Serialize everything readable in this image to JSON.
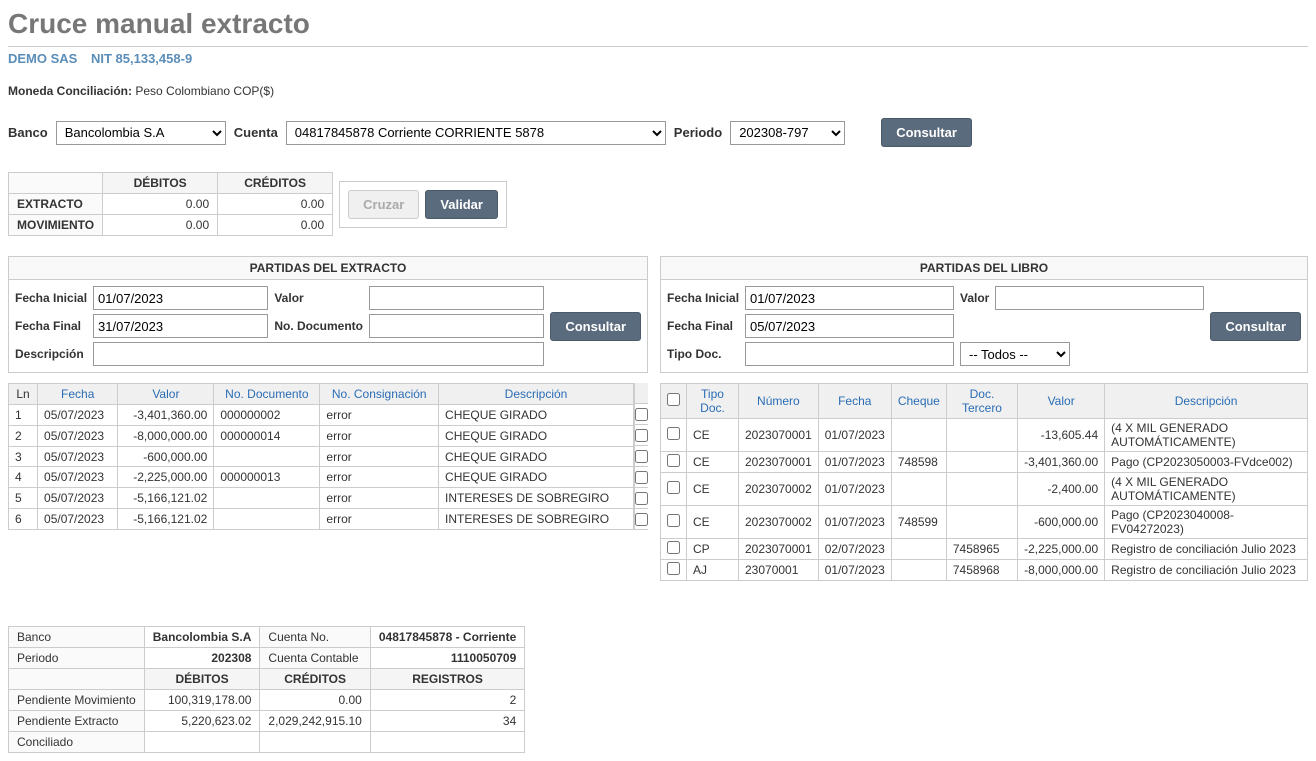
{
  "page": {
    "title": "Cruce manual extracto",
    "company": "DEMO SAS",
    "nit_label": "NIT",
    "nit": "85,133,458-9",
    "moneda_label": "Moneda Conciliación:",
    "moneda_value": "Peso Colombiano COP($)"
  },
  "filters": {
    "banco_label": "Banco",
    "banco_value": "Bancolombia S.A",
    "cuenta_label": "Cuenta",
    "cuenta_value": "04817845878 Corriente CORRIENTE 5878",
    "periodo_label": "Periodo",
    "periodo_value": "202308-797",
    "consultar": "Consultar"
  },
  "summary": {
    "h_debitos": "DÉBITOS",
    "h_creditos": "CRÉDITOS",
    "r_extracto": "EXTRACTO",
    "r_movimiento": "MOVIMIENTO",
    "ext_deb": "0.00",
    "ext_cre": "0.00",
    "mov_deb": "0.00",
    "mov_cre": "0.00",
    "cruzar": "Cruzar",
    "validar": "Validar"
  },
  "extracto": {
    "panel_title": "PARTIDAS DEL EXTRACTO",
    "fecha_ini_label": "Fecha Inicial",
    "fecha_ini": "01/07/2023",
    "fecha_fin_label": "Fecha Final",
    "fecha_fin": "31/07/2023",
    "valor_label": "Valor",
    "valor": "",
    "nodoc_label": "No. Documento",
    "nodoc": "",
    "desc_label": "Descripción",
    "desc": "",
    "consultar": "Consultar",
    "cols": {
      "ln": "Ln",
      "fecha": "Fecha",
      "valor": "Valor",
      "nodoc": "No. Documento",
      "nocons": "No. Consignación",
      "desc": "Descripción"
    },
    "rows": [
      {
        "ln": "1",
        "fecha": "05/07/2023",
        "valor": "-3,401,360.00",
        "nodoc": "000000002",
        "nocons": "error",
        "desc": "CHEQUE GIRADO"
      },
      {
        "ln": "2",
        "fecha": "05/07/2023",
        "valor": "-8,000,000.00",
        "nodoc": "000000014",
        "nocons": "error",
        "desc": "CHEQUE GIRADO"
      },
      {
        "ln": "3",
        "fecha": "05/07/2023",
        "valor": "-600,000.00",
        "nodoc": "",
        "nocons": "error",
        "desc": "CHEQUE GIRADO"
      },
      {
        "ln": "4",
        "fecha": "05/07/2023",
        "valor": "-2,225,000.00",
        "nodoc": "000000013",
        "nocons": "error",
        "desc": "CHEQUE GIRADO"
      },
      {
        "ln": "5",
        "fecha": "05/07/2023",
        "valor": "-5,166,121.02",
        "nodoc": "",
        "nocons": "error",
        "desc": "INTERESES DE SOBREGIRO"
      },
      {
        "ln": "6",
        "fecha": "05/07/2023",
        "valor": "-5,166,121.02",
        "nodoc": "",
        "nocons": "error",
        "desc": "INTERESES DE SOBREGIRO"
      }
    ]
  },
  "libro": {
    "panel_title": "PARTIDAS DEL LIBRO",
    "fecha_ini_label": "Fecha Inicial",
    "fecha_ini": "01/07/2023",
    "fecha_fin_label": "Fecha Final",
    "fecha_fin": "05/07/2023",
    "valor_label": "Valor",
    "valor": "",
    "tipo_label": "Tipo Doc.",
    "tipo": "",
    "todos_label": "-- Todos --",
    "consultar": "Consultar",
    "cols": {
      "tipo": "Tipo Doc.",
      "num": "Número",
      "fecha": "Fecha",
      "cheque": "Cheque",
      "tercero": "Doc. Tercero",
      "valor": "Valor",
      "desc": "Descripción"
    },
    "rows": [
      {
        "tipo": "CE",
        "num": "2023070001",
        "fecha": "01/07/2023",
        "cheque": "",
        "tercero": "",
        "valor": "-13,605.44",
        "desc": "(4 X MIL GENERADO AUTOMÁTICAMENTE)"
      },
      {
        "tipo": "CE",
        "num": "2023070001",
        "fecha": "01/07/2023",
        "cheque": "748598",
        "tercero": "",
        "valor": "-3,401,360.00",
        "desc": "Pago  (CP2023050003-FVdce002)"
      },
      {
        "tipo": "CE",
        "num": "2023070002",
        "fecha": "01/07/2023",
        "cheque": "",
        "tercero": "",
        "valor": "-2,400.00",
        "desc": "(4 X MIL GENERADO AUTOMÁTICAMENTE)"
      },
      {
        "tipo": "CE",
        "num": "2023070002",
        "fecha": "01/07/2023",
        "cheque": "748599",
        "tercero": "",
        "valor": "-600,000.00",
        "desc": "Pago  (CP2023040008-FV04272023)"
      },
      {
        "tipo": "CP",
        "num": "2023070001",
        "fecha": "02/07/2023",
        "cheque": "",
        "tercero": "7458965",
        "valor": "-2,225,000.00",
        "desc": "Registro de conciliación Julio 2023"
      },
      {
        "tipo": "AJ",
        "num": "23070001",
        "fecha": "01/07/2023",
        "cheque": "",
        "tercero": "7458968",
        "valor": "-8,000,000.00",
        "desc": "Registro de conciliación Julio 2023"
      }
    ]
  },
  "footer": {
    "banco_l": "Banco",
    "banco_v": "Bancolombia S.A",
    "cuentano_l": "Cuenta No.",
    "cuentano_v": "04817845878 - Corriente",
    "periodo_l": "Periodo",
    "periodo_v": "202308",
    "contable_l": "Cuenta Contable",
    "contable_v": "1110050709",
    "h_deb": "DÉBITOS",
    "h_cre": "CRÉDITOS",
    "h_reg": "REGISTROS",
    "pend_mov_l": "Pendiente Movimiento",
    "pend_mov_deb": "100,319,178.00",
    "pend_mov_cre": "0.00",
    "pend_mov_reg": "2",
    "pend_ext_l": "Pendiente Extracto",
    "pend_ext_deb": "5,220,623.02",
    "pend_ext_cre": "2,029,242,915.10",
    "pend_ext_reg": "34",
    "conc_l": "Conciliado",
    "conc_deb": "",
    "conc_cre": "",
    "conc_reg": ""
  }
}
